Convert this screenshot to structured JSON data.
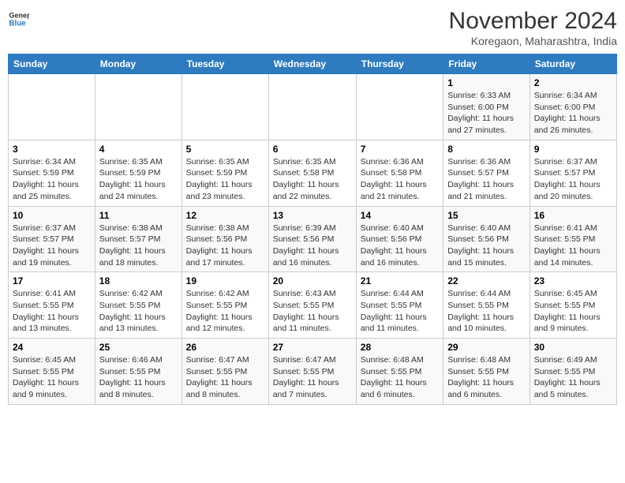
{
  "header": {
    "logo_line1": "General",
    "logo_line2": "Blue",
    "month_title": "November 2024",
    "location": "Koregaon, Maharashtra, India"
  },
  "weekdays": [
    "Sunday",
    "Monday",
    "Tuesday",
    "Wednesday",
    "Thursday",
    "Friday",
    "Saturday"
  ],
  "weeks": [
    [
      {
        "day": "",
        "detail": ""
      },
      {
        "day": "",
        "detail": ""
      },
      {
        "day": "",
        "detail": ""
      },
      {
        "day": "",
        "detail": ""
      },
      {
        "day": "",
        "detail": ""
      },
      {
        "day": "1",
        "detail": "Sunrise: 6:33 AM\nSunset: 6:00 PM\nDaylight: 11 hours and 27 minutes."
      },
      {
        "day": "2",
        "detail": "Sunrise: 6:34 AM\nSunset: 6:00 PM\nDaylight: 11 hours and 26 minutes."
      }
    ],
    [
      {
        "day": "3",
        "detail": "Sunrise: 6:34 AM\nSunset: 5:59 PM\nDaylight: 11 hours and 25 minutes."
      },
      {
        "day": "4",
        "detail": "Sunrise: 6:35 AM\nSunset: 5:59 PM\nDaylight: 11 hours and 24 minutes."
      },
      {
        "day": "5",
        "detail": "Sunrise: 6:35 AM\nSunset: 5:59 PM\nDaylight: 11 hours and 23 minutes."
      },
      {
        "day": "6",
        "detail": "Sunrise: 6:35 AM\nSunset: 5:58 PM\nDaylight: 11 hours and 22 minutes."
      },
      {
        "day": "7",
        "detail": "Sunrise: 6:36 AM\nSunset: 5:58 PM\nDaylight: 11 hours and 21 minutes."
      },
      {
        "day": "8",
        "detail": "Sunrise: 6:36 AM\nSunset: 5:57 PM\nDaylight: 11 hours and 21 minutes."
      },
      {
        "day": "9",
        "detail": "Sunrise: 6:37 AM\nSunset: 5:57 PM\nDaylight: 11 hours and 20 minutes."
      }
    ],
    [
      {
        "day": "10",
        "detail": "Sunrise: 6:37 AM\nSunset: 5:57 PM\nDaylight: 11 hours and 19 minutes."
      },
      {
        "day": "11",
        "detail": "Sunrise: 6:38 AM\nSunset: 5:57 PM\nDaylight: 11 hours and 18 minutes."
      },
      {
        "day": "12",
        "detail": "Sunrise: 6:38 AM\nSunset: 5:56 PM\nDaylight: 11 hours and 17 minutes."
      },
      {
        "day": "13",
        "detail": "Sunrise: 6:39 AM\nSunset: 5:56 PM\nDaylight: 11 hours and 16 minutes."
      },
      {
        "day": "14",
        "detail": "Sunrise: 6:40 AM\nSunset: 5:56 PM\nDaylight: 11 hours and 16 minutes."
      },
      {
        "day": "15",
        "detail": "Sunrise: 6:40 AM\nSunset: 5:56 PM\nDaylight: 11 hours and 15 minutes."
      },
      {
        "day": "16",
        "detail": "Sunrise: 6:41 AM\nSunset: 5:55 PM\nDaylight: 11 hours and 14 minutes."
      }
    ],
    [
      {
        "day": "17",
        "detail": "Sunrise: 6:41 AM\nSunset: 5:55 PM\nDaylight: 11 hours and 13 minutes."
      },
      {
        "day": "18",
        "detail": "Sunrise: 6:42 AM\nSunset: 5:55 PM\nDaylight: 11 hours and 13 minutes."
      },
      {
        "day": "19",
        "detail": "Sunrise: 6:42 AM\nSunset: 5:55 PM\nDaylight: 11 hours and 12 minutes."
      },
      {
        "day": "20",
        "detail": "Sunrise: 6:43 AM\nSunset: 5:55 PM\nDaylight: 11 hours and 11 minutes."
      },
      {
        "day": "21",
        "detail": "Sunrise: 6:44 AM\nSunset: 5:55 PM\nDaylight: 11 hours and 11 minutes."
      },
      {
        "day": "22",
        "detail": "Sunrise: 6:44 AM\nSunset: 5:55 PM\nDaylight: 11 hours and 10 minutes."
      },
      {
        "day": "23",
        "detail": "Sunrise: 6:45 AM\nSunset: 5:55 PM\nDaylight: 11 hours and 9 minutes."
      }
    ],
    [
      {
        "day": "24",
        "detail": "Sunrise: 6:45 AM\nSunset: 5:55 PM\nDaylight: 11 hours and 9 minutes."
      },
      {
        "day": "25",
        "detail": "Sunrise: 6:46 AM\nSunset: 5:55 PM\nDaylight: 11 hours and 8 minutes."
      },
      {
        "day": "26",
        "detail": "Sunrise: 6:47 AM\nSunset: 5:55 PM\nDaylight: 11 hours and 8 minutes."
      },
      {
        "day": "27",
        "detail": "Sunrise: 6:47 AM\nSunset: 5:55 PM\nDaylight: 11 hours and 7 minutes."
      },
      {
        "day": "28",
        "detail": "Sunrise: 6:48 AM\nSunset: 5:55 PM\nDaylight: 11 hours and 6 minutes."
      },
      {
        "day": "29",
        "detail": "Sunrise: 6:48 AM\nSunset: 5:55 PM\nDaylight: 11 hours and 6 minutes."
      },
      {
        "day": "30",
        "detail": "Sunrise: 6:49 AM\nSunset: 5:55 PM\nDaylight: 11 hours and 5 minutes."
      }
    ]
  ]
}
